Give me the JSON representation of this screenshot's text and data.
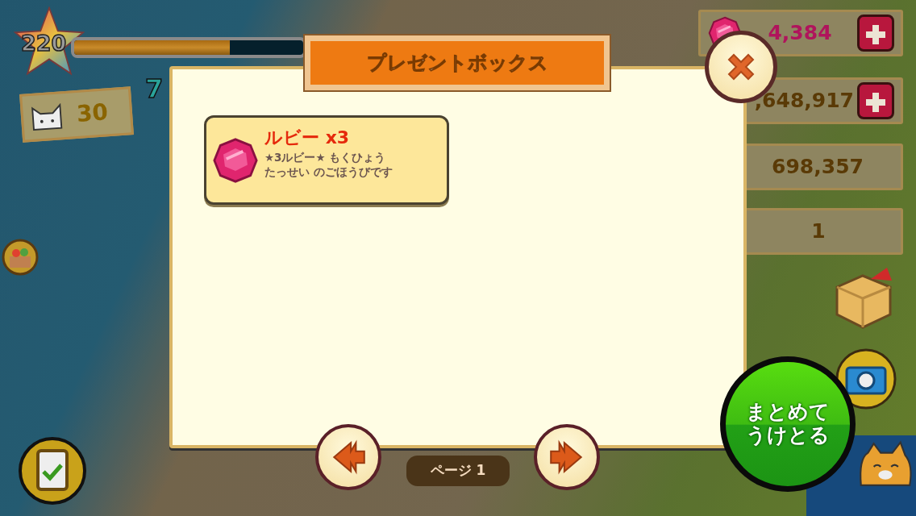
{
  "hud": {
    "player_level": "220",
    "xp": {
      "level": 0.68
    },
    "cats": "30",
    "side_number": "7"
  },
  "currencies": [
    {
      "kind": "ruby",
      "value": "4,384",
      "plus": true
    },
    {
      "kind": "hidden",
      "value": ",648,917",
      "plus": true
    },
    {
      "kind": "coin",
      "value": "698,357",
      "plus": false
    },
    {
      "kind": "shell",
      "value": "1",
      "plus": false
    }
  ],
  "dialog": {
    "title": "プレゼントボックス",
    "items": [
      {
        "kind": "ruby",
        "name": "ルビー x3",
        "description_lines": [
          "★3ルビー★ もくひょう",
          "たっせい のごほうびです"
        ]
      }
    ],
    "page": "ページ 1"
  },
  "collect_all_button": "まとめてうけとる"
}
